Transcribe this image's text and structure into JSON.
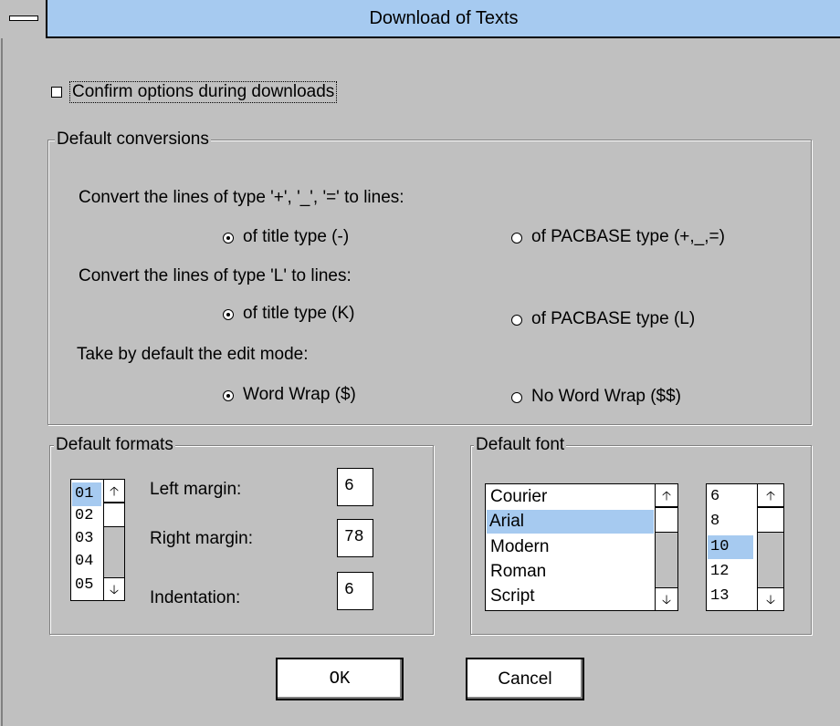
{
  "window": {
    "title": "Download of Texts"
  },
  "confirm": {
    "label": "Confirm options during downloads",
    "checked": false
  },
  "conversions": {
    "legend": "Default conversions",
    "line_plus": {
      "prompt": "Convert the lines of type '+', '_', '=' to lines:",
      "opt_title": "of title type (-)",
      "opt_pacbase": "of PACBASE type (+,_,=)",
      "selected": "title"
    },
    "line_L": {
      "prompt": "Convert the lines of type 'L' to lines:",
      "opt_title": "of title type (K)",
      "opt_pacbase": "of PACBASE type (L)",
      "selected": "title"
    },
    "edit_mode": {
      "prompt": "Take by default the edit mode:",
      "opt_wrap": "Word Wrap ($)",
      "opt_nowrap": "No Word Wrap ($$)",
      "selected": "wrap"
    }
  },
  "formats": {
    "legend": "Default formats",
    "list": [
      "01",
      "02",
      "03",
      "04",
      "05"
    ],
    "selected": "01",
    "left_margin_label": "Left margin:",
    "left_margin": "6",
    "right_margin_label": "Right margin:",
    "right_margin": "78",
    "indentation_label": "Indentation:",
    "indentation": "6"
  },
  "font": {
    "legend": "Default font",
    "faces": [
      "Courier",
      "Arial",
      "Modern",
      "Roman",
      "Script"
    ],
    "selected_face": "Arial",
    "sizes": [
      "6",
      "8",
      "10",
      "12",
      "13"
    ],
    "selected_size": "10"
  },
  "buttons": {
    "ok": "OK",
    "cancel": "Cancel"
  },
  "icons": {
    "scroll_up": "up-arrow-icon",
    "scroll_down": "down-arrow-icon",
    "system_menu": "system-menu-icon"
  },
  "colors": {
    "title_bar": "#a6caf0",
    "selection": "#a6caf0",
    "dialog_bg": "#c0c0c0"
  }
}
